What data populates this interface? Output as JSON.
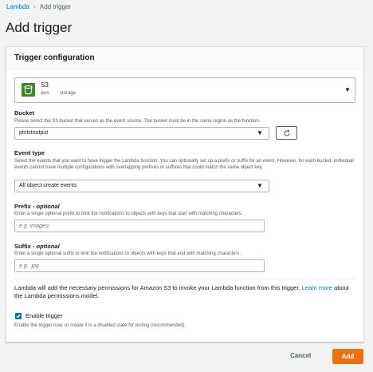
{
  "breadcrumb": {
    "root": "Lambda",
    "current": "Add trigger"
  },
  "page": {
    "title": "Add trigger"
  },
  "panel": {
    "title": "Trigger configuration"
  },
  "source": {
    "name": "S3",
    "tags": [
      "aws",
      "storage"
    ],
    "icon": "s3-icon",
    "icon_color": "#3f8624"
  },
  "bucket": {
    "label": "Bucket",
    "description": "Please select the S3 bucket that serves as the event source. The bucket must be in the same region as the function.",
    "value": "ptctstoutput"
  },
  "event_type": {
    "label": "Event type",
    "description": "Select the events that you want to have trigger the Lambda function. You can optionally set up a prefix or suffix for an event. However, for each bucket, individual events cannot have multiple configurations with overlapping prefixes or suffixes that could match the same object key.",
    "value": "All object create events"
  },
  "prefix": {
    "label": "Prefix",
    "optional": "optional",
    "description": "Enter a single optional prefix to limit the notifications to objects with keys that start with matching characters.",
    "placeholder": "e.g. images/"
  },
  "suffix": {
    "label": "Suffix",
    "optional": "optional",
    "description": "Enter a single optional suffix to limit the notifications to objects with keys that end with matching characters.",
    "placeholder": "e.g. .jpg"
  },
  "permissions": {
    "text": "Lambda will add the necessary permissions for Amazon S3 to invoke your Lambda function from this trigger.",
    "link_text": "Learn more",
    "text_after": "about the Lambda permissions model."
  },
  "enable_trigger": {
    "label": "Enable trigger",
    "checked": true,
    "description": "Enable the trigger now, or create it in a disabled state for testing (recommended)."
  },
  "footer": {
    "cancel": "Cancel",
    "add": "Add"
  },
  "colors": {
    "link": "#0073bb",
    "primary_button": "#ec7211",
    "checkbox": "#0073bb"
  }
}
